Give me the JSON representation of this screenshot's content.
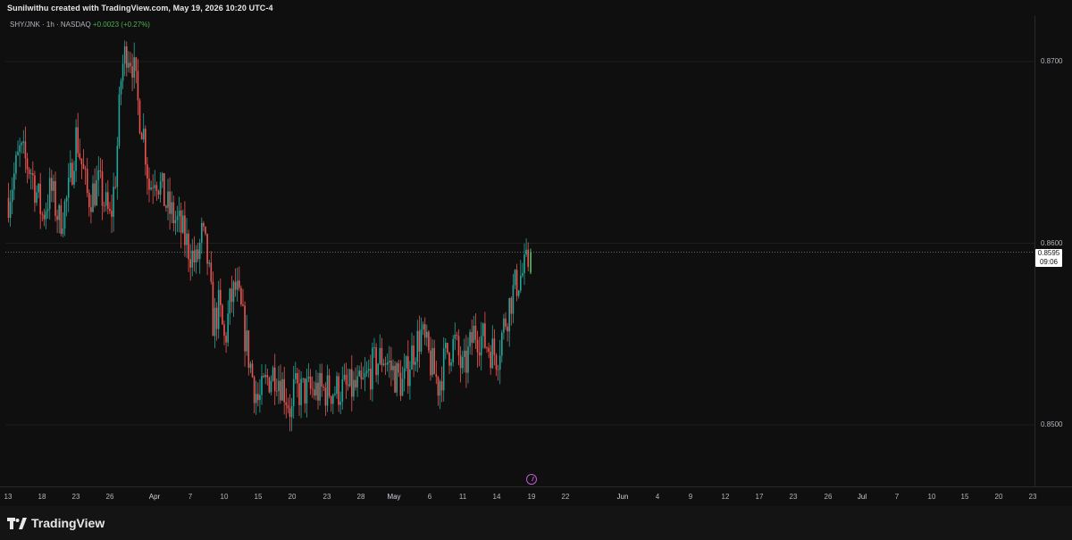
{
  "header": {
    "credit": "Sunilwithu created with TradingView.com, May 19, 2026 10:20 UTC-4"
  },
  "legend": {
    "symbol": "SHY/JNK · 1h · NASDAQ",
    "change": "+0.0023 (+0.27%)"
  },
  "last_price": {
    "value": "0.8595",
    "countdown": "09:06"
  },
  "footer": {
    "brand": "TradingView"
  },
  "colors": {
    "up": "#26a69a",
    "up_bright": "#4caf50",
    "down": "#ef5350",
    "background": "#0f0f0f",
    "grid": "#1e1e1e",
    "event": "#c45ad6"
  },
  "icons": {
    "event": "lightning-bolt-icon",
    "brand_logo": "tradingview-logo-icon"
  },
  "chart_data": {
    "type": "candlestick",
    "title": "SHY/JNK · 1h · NASDAQ",
    "ylim": [
      0.849,
      0.8715
    ],
    "y_ticks": [
      "0.8700",
      "0.8600",
      "0.8500"
    ],
    "x_ticks": [
      "13",
      "18",
      "23",
      "26",
      "Apr",
      "7",
      "10",
      "15",
      "20",
      "23",
      "28",
      "May",
      "6",
      "11",
      "14",
      "19",
      "22",
      "Jun",
      "4",
      "9",
      "12",
      "17",
      "23",
      "26",
      "Jul",
      "7",
      "10",
      "15",
      "20",
      "23"
    ],
    "x_tick_bold": [
      "Apr",
      "May",
      "Jun",
      "Jul"
    ],
    "last_value": 0.8595,
    "segments": [
      {
        "from": "13",
        "to": "18",
        "vals": [
          0.8625,
          0.865,
          0.864,
          0.8615
        ]
      },
      {
        "from": "18",
        "to": "23",
        "vals": [
          0.8615,
          0.863,
          0.8612,
          0.8625,
          0.866
        ]
      },
      {
        "from": "23",
        "to": "26",
        "vals": [
          0.866,
          0.8625,
          0.8632,
          0.8612
        ]
      },
      {
        "from": "26",
        "to": "Apr",
        "vals": [
          0.8612,
          0.864,
          0.8695,
          0.8708,
          0.87,
          0.8675,
          0.866,
          0.863,
          0.864
        ]
      },
      {
        "from": "Apr",
        "to": "7",
        "vals": [
          0.864,
          0.862,
          0.861,
          0.8595
        ]
      },
      {
        "from": "7",
        "to": "10",
        "vals": [
          0.8595,
          0.8588,
          0.8605,
          0.859,
          0.8555,
          0.8565,
          0.8545
        ]
      },
      {
        "from": "10",
        "to": "15",
        "vals": [
          0.8545,
          0.8568,
          0.8575,
          0.856,
          0.8542,
          0.8525,
          0.8512
        ]
      },
      {
        "from": "15",
        "to": "20",
        "vals": [
          0.8512,
          0.8525,
          0.853,
          0.852,
          0.8505
        ]
      },
      {
        "from": "20",
        "to": "23",
        "vals": [
          0.8505,
          0.852,
          0.8525,
          0.8518
        ]
      },
      {
        "from": "23",
        "to": "28",
        "vals": [
          0.8518,
          0.8528,
          0.8522,
          0.8518,
          0.852
        ]
      },
      {
        "from": "28",
        "to": "May",
        "vals": [
          0.852,
          0.8532,
          0.8538,
          0.8528
        ]
      },
      {
        "from": "May",
        "to": "6",
        "vals": [
          0.8528,
          0.8522,
          0.854,
          0.855,
          0.8535
        ]
      },
      {
        "from": "6",
        "to": "11",
        "vals": [
          0.8535,
          0.8522,
          0.854,
          0.8545,
          0.8528
        ]
      },
      {
        "from": "11",
        "to": "14",
        "vals": [
          0.8528,
          0.8552,
          0.8545,
          0.8538
        ]
      },
      {
        "from": "14",
        "to": "19",
        "vals": [
          0.8538,
          0.8555,
          0.857,
          0.858,
          0.8585,
          0.8595
        ]
      }
    ]
  }
}
